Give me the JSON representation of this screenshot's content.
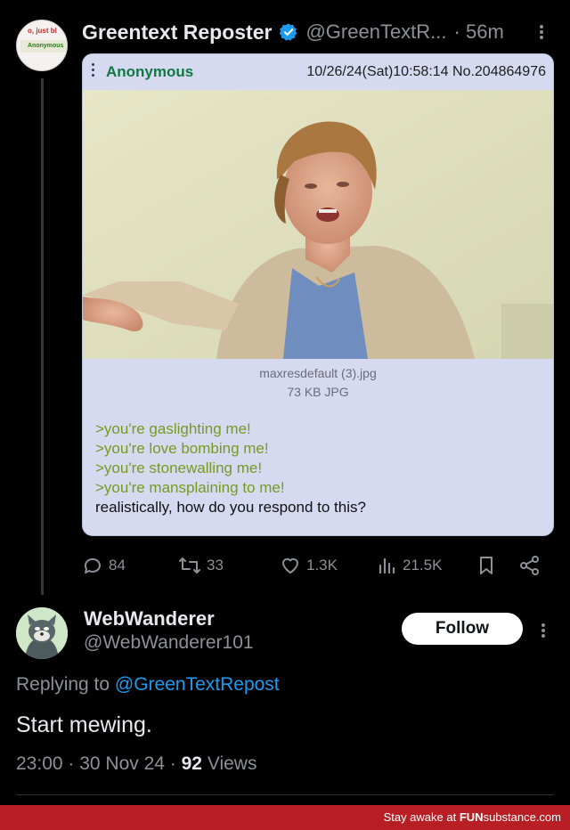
{
  "top_avatar": {
    "snippet_text": "o, just bl",
    "snippet_label": "Anonymous"
  },
  "author": {
    "name": "Greentext Reposter",
    "handle": "@GreenTextR...",
    "time": "· 56m"
  },
  "card": {
    "poster": "Anonymous",
    "meta": "10/26/24(Sat)10:58:14 No.204864976",
    "file_name": "maxresdefault (3).jpg",
    "file_size": "73 KB JPG",
    "greentext": [
      ">you're gaslighting me!",
      ">you're love bombing me!",
      ">you're stonewalling me!",
      ">you're mansplaining to me!"
    ],
    "normal_line": "realistically, how do you respond to this?"
  },
  "actions": {
    "replies": "84",
    "reposts": "33",
    "likes": "1.3K",
    "views": "21.5K"
  },
  "reply": {
    "name": "WebWanderer",
    "handle": "@WebWanderer101",
    "follow_label": "Follow",
    "replying_prefix": "Replying to",
    "replying_to": "@GreenTextRepost",
    "text": "Start mewing.",
    "meta_prefix": "23:00 · 30 Nov 24 ·",
    "views_count": "92",
    "views_label": "Views"
  },
  "footer": {
    "prefix": "Stay awake at",
    "brand_bold": "FUN",
    "brand_rest": "substance.com"
  },
  "colors": {
    "accent": "#1d9bf0",
    "card_bg": "#d6daf0",
    "greentext": "#789922",
    "poster_name": "#117743",
    "footer_bg": "#b71f24"
  }
}
